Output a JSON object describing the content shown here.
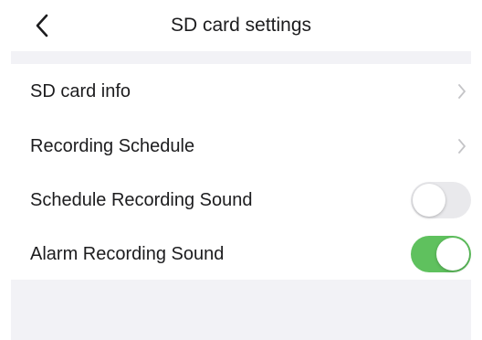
{
  "header": {
    "title": "SD card settings",
    "back_icon": "chevron-left-icon"
  },
  "settings": {
    "sd_card_info": {
      "label": "SD card info",
      "icon": "chevron-right-icon"
    },
    "recording_schedule": {
      "label": "Recording Schedule",
      "icon": "chevron-right-icon"
    },
    "schedule_recording_sound": {
      "label": "Schedule Recording Sound",
      "enabled": false
    },
    "alarm_recording_sound": {
      "label": "Alarm Recording Sound",
      "enabled": true
    }
  },
  "colors": {
    "toggle_on": "#5fc15e",
    "toggle_off": "#e9e9ec",
    "section_background": "#f2f2f6"
  }
}
